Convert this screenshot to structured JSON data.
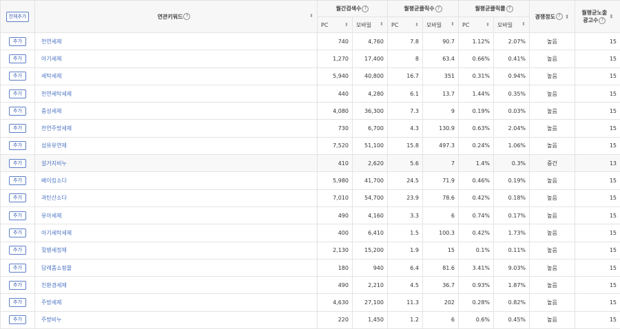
{
  "header": {
    "add_all_label": "전체추가",
    "keyword_col": "연관키워드",
    "monthly_search": "월간검색수",
    "avg_clicks": "월평균클릭수",
    "avg_ctr": "월평균클릭률",
    "competition": "경쟁정도",
    "avg_ads_line1": "월평균노출",
    "avg_ads_line2": "광고수",
    "pc": "PC",
    "mobile": "모바일",
    "help_glyph": "?",
    "sort_glyph": "⬍"
  },
  "add_label": "추가",
  "rows": [
    {
      "keyword": "천연세제",
      "pc_search": "740",
      "mo_search": "4,760",
      "pc_click": "7.8",
      "mo_click": "90.7",
      "pc_ctr": "1.12%",
      "mo_ctr": "2.07%",
      "comp": "높음",
      "ads": "15"
    },
    {
      "keyword": "아기세제",
      "pc_search": "1,270",
      "mo_search": "17,400",
      "pc_click": "8",
      "mo_click": "63.4",
      "pc_ctr": "0.66%",
      "mo_ctr": "0.41%",
      "comp": "높음",
      "ads": "15"
    },
    {
      "keyword": "세탁세제",
      "pc_search": "5,940",
      "mo_search": "40,800",
      "pc_click": "16.7",
      "mo_click": "351",
      "pc_ctr": "0.31%",
      "mo_ctr": "0.94%",
      "comp": "높음",
      "ads": "15"
    },
    {
      "keyword": "천연세탁세제",
      "pc_search": "440",
      "mo_search": "4,280",
      "pc_click": "6.1",
      "mo_click": "13.7",
      "pc_ctr": "1.44%",
      "mo_ctr": "0.35%",
      "comp": "높음",
      "ads": "15"
    },
    {
      "keyword": "중성세제",
      "pc_search": "4,080",
      "mo_search": "36,300",
      "pc_click": "7.3",
      "mo_click": "9",
      "pc_ctr": "0.19%",
      "mo_ctr": "0.03%",
      "comp": "높음",
      "ads": "15"
    },
    {
      "keyword": "천연주방세제",
      "pc_search": "730",
      "mo_search": "6,700",
      "pc_click": "4.3",
      "mo_click": "130.9",
      "pc_ctr": "0.63%",
      "mo_ctr": "2.04%",
      "comp": "높음",
      "ads": "15"
    },
    {
      "keyword": "섬유유연제",
      "pc_search": "7,520",
      "mo_search": "51,100",
      "pc_click": "15.8",
      "mo_click": "497.3",
      "pc_ctr": "0.24%",
      "mo_ctr": "1.06%",
      "comp": "높음",
      "ads": "15"
    },
    {
      "keyword": "설거지비누",
      "pc_search": "410",
      "mo_search": "2,620",
      "pc_click": "5.6",
      "mo_click": "7",
      "pc_ctr": "1.4%",
      "mo_ctr": "0.3%",
      "comp": "중간",
      "ads": "13"
    },
    {
      "keyword": "베이킹소다",
      "pc_search": "5,980",
      "mo_search": "41,700",
      "pc_click": "24.5",
      "mo_click": "71.9",
      "pc_ctr": "0.46%",
      "mo_ctr": "0.19%",
      "comp": "높음",
      "ads": "15"
    },
    {
      "keyword": "과탄산소다",
      "pc_search": "7,010",
      "mo_search": "54,700",
      "pc_click": "23.9",
      "mo_click": "78.6",
      "pc_ctr": "0.42%",
      "mo_ctr": "0.18%",
      "comp": "높음",
      "ads": "15"
    },
    {
      "keyword": "유아세제",
      "pc_search": "490",
      "mo_search": "4,160",
      "pc_click": "3.3",
      "mo_click": "6",
      "pc_ctr": "0.74%",
      "mo_ctr": "0.17%",
      "comp": "높음",
      "ads": "15"
    },
    {
      "keyword": "아기세탁세제",
      "pc_search": "400",
      "mo_search": "6,410",
      "pc_click": "1.5",
      "mo_click": "100.3",
      "pc_ctr": "0.42%",
      "mo_ctr": "1.73%",
      "comp": "높음",
      "ads": "15"
    },
    {
      "keyword": "젖병세정제",
      "pc_search": "2,130",
      "mo_search": "15,200",
      "pc_click": "1.9",
      "mo_click": "15",
      "pc_ctr": "0.1%",
      "mo_ctr": "0.11%",
      "comp": "높음",
      "ads": "15"
    },
    {
      "keyword": "답례품쇼핑몰",
      "pc_search": "180",
      "mo_search": "940",
      "pc_click": "6.4",
      "mo_click": "81.6",
      "pc_ctr": "3.41%",
      "mo_ctr": "9.03%",
      "comp": "높음",
      "ads": "15"
    },
    {
      "keyword": "친환경세제",
      "pc_search": "490",
      "mo_search": "2,210",
      "pc_click": "4.5",
      "mo_click": "36.7",
      "pc_ctr": "0.93%",
      "mo_ctr": "1.87%",
      "comp": "높음",
      "ads": "15"
    },
    {
      "keyword": "주방세제",
      "pc_search": "4,630",
      "mo_search": "27,100",
      "pc_click": "11.3",
      "mo_click": "202",
      "pc_ctr": "0.28%",
      "mo_ctr": "0.82%",
      "comp": "높음",
      "ads": "15"
    },
    {
      "keyword": "주방비누",
      "pc_search": "220",
      "mo_search": "1,450",
      "pc_click": "1.2",
      "mo_click": "6",
      "pc_ctr": "0.6%",
      "mo_ctr": "0.45%",
      "comp": "높음",
      "ads": "15"
    }
  ]
}
